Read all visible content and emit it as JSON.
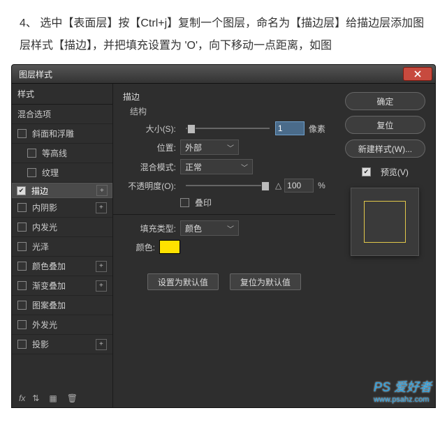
{
  "instruction": {
    "number": "4、",
    "t1": "选中【表面层】按【Ctrl+j】复制一个图层，命名为【描边层】给描边层添加图层样式【描边】，并把填充设置为 'O'，向下移动一点距离，如图"
  },
  "dialog": {
    "title": "图层样式",
    "left_header": "样式",
    "blend_options": "混合选项",
    "styles": [
      {
        "label": "斜面和浮雕",
        "checked": false
      },
      {
        "label": "等高线",
        "checked": false,
        "indent": true
      },
      {
        "label": "纹理",
        "checked": false,
        "indent": true
      },
      {
        "label": "描边",
        "checked": true,
        "plus": true,
        "selected": true
      },
      {
        "label": "内阴影",
        "checked": false,
        "plus": true
      },
      {
        "label": "内发光",
        "checked": false
      },
      {
        "label": "光泽",
        "checked": false
      },
      {
        "label": "颜色叠加",
        "checked": false,
        "plus": true
      },
      {
        "label": "渐变叠加",
        "checked": false,
        "plus": true
      },
      {
        "label": "图案叠加",
        "checked": false
      },
      {
        "label": "外发光",
        "checked": false
      },
      {
        "label": "投影",
        "checked": false,
        "plus": true
      }
    ],
    "footer_fx": "fx",
    "mid": {
      "group": "描边",
      "structure": "结构",
      "size_label": "大小(S):",
      "size_value": "1",
      "size_unit": "像素",
      "position_label": "位置:",
      "position_value": "外部",
      "blend_label": "混合模式:",
      "blend_value": "正常",
      "opacity_label": "不透明度(O):",
      "opacity_value": "100",
      "opacity_unit": "%",
      "overprint": "叠印",
      "filltype_label": "填充类型:",
      "filltype_value": "颜色",
      "color_label": "颜色:",
      "btn_default": "设置为默认值",
      "btn_reset": "复位为默认值"
    },
    "right": {
      "ok": "确定",
      "cancel": "复位",
      "newstyle": "新建样式(W)...",
      "preview_label": "预览(V)"
    }
  },
  "watermark": {
    "brand": "PS 爱好者",
    "url": "www.psahz.com"
  },
  "colors": {
    "swatch": "#ffe200"
  }
}
